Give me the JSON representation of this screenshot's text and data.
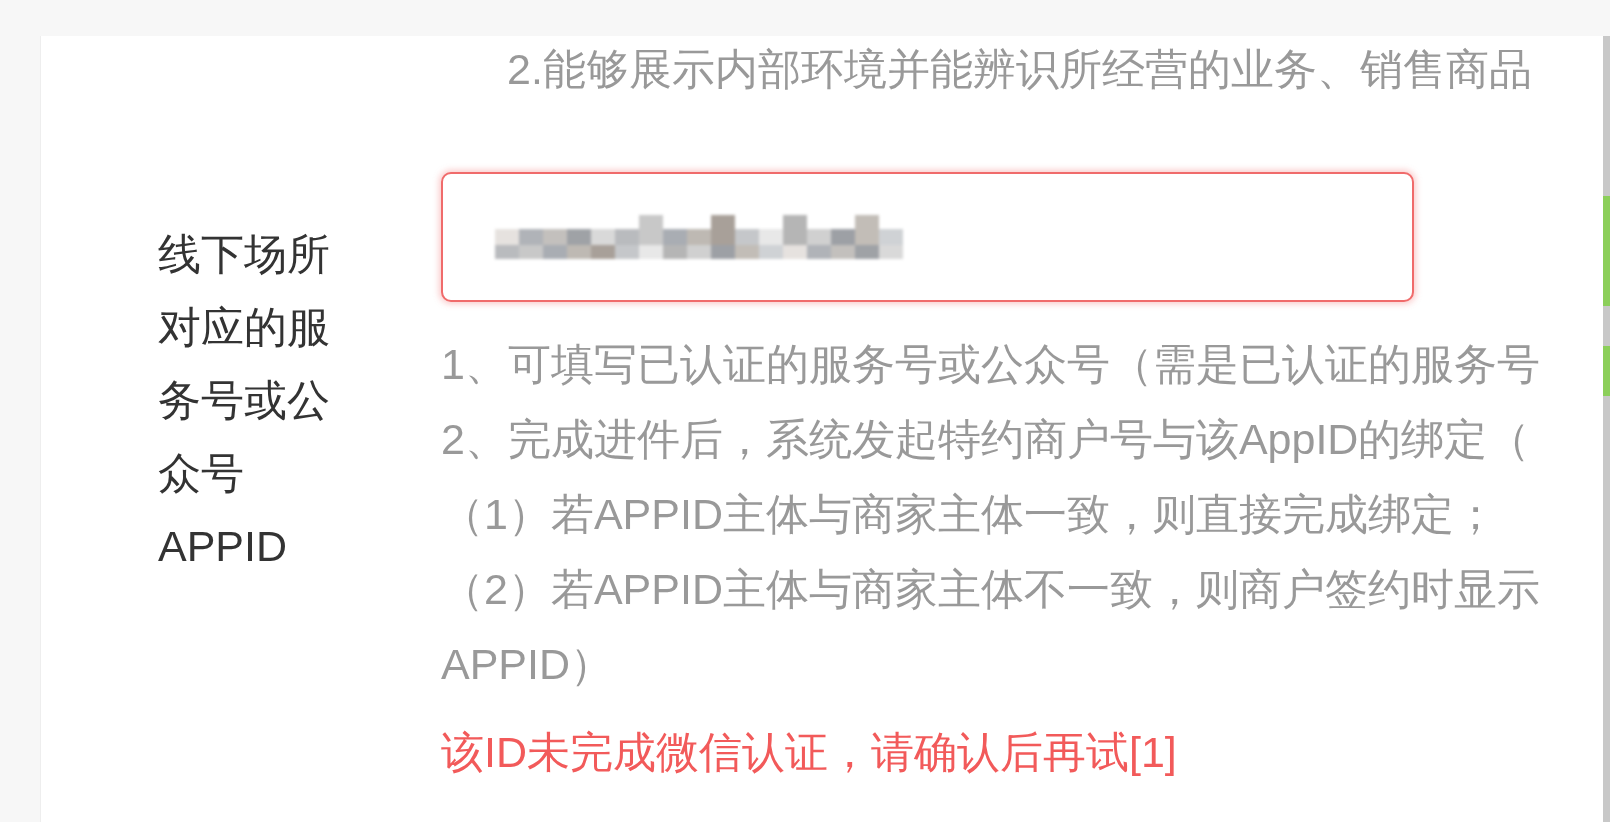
{
  "intro_line": "2.能够展示内部环境并能辨识所经营的业务、销售商品",
  "field": {
    "label_lines": [
      "线下场所",
      "对应的服",
      "务号或公",
      "众号",
      "APPID"
    ],
    "redacted": true,
    "invalid": true
  },
  "help_lines": [
    "1、可填写已认证的服务号或公众号（需是已认证的服务号",
    "2、完成进件后，系统发起特约商户号与该AppID的绑定（",
    "（1）若APPID主体与商家主体一致，则直接完成绑定；",
    "（2）若APPID主体与商家主体不一致，则商户签约时显示",
    "APPID）"
  ],
  "error": "该ID未完成微信认证，请确认后再试[1]"
}
